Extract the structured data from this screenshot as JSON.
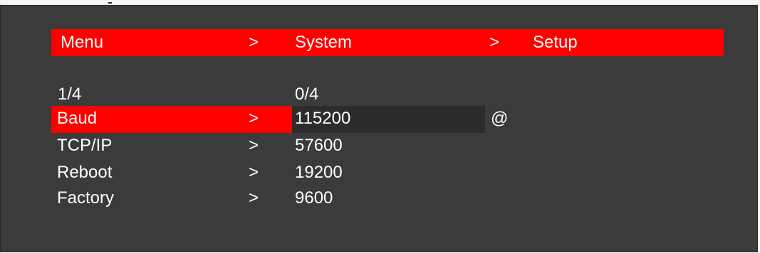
{
  "header": {
    "crumb1": "Menu",
    "sep1": ">",
    "crumb2": "System",
    "sep2": ">",
    "crumb3": "Setup"
  },
  "page_counters": {
    "left": "1/4",
    "right": "0/4"
  },
  "menu_items": [
    {
      "label": "Baud",
      "arrow": ">",
      "value": "115200",
      "marker": "@"
    },
    {
      "label": "TCP/IP",
      "arrow": ">",
      "value": "57600"
    },
    {
      "label": "Reboot",
      "arrow": ">",
      "value": "19200"
    },
    {
      "label": "Factory",
      "arrow": ">",
      "value": "9600"
    }
  ],
  "colors": {
    "background": "#3b3b3b",
    "highlight": "#ff0000",
    "text": "#ffffff",
    "selected_value_bg": "#2c2c2c"
  }
}
